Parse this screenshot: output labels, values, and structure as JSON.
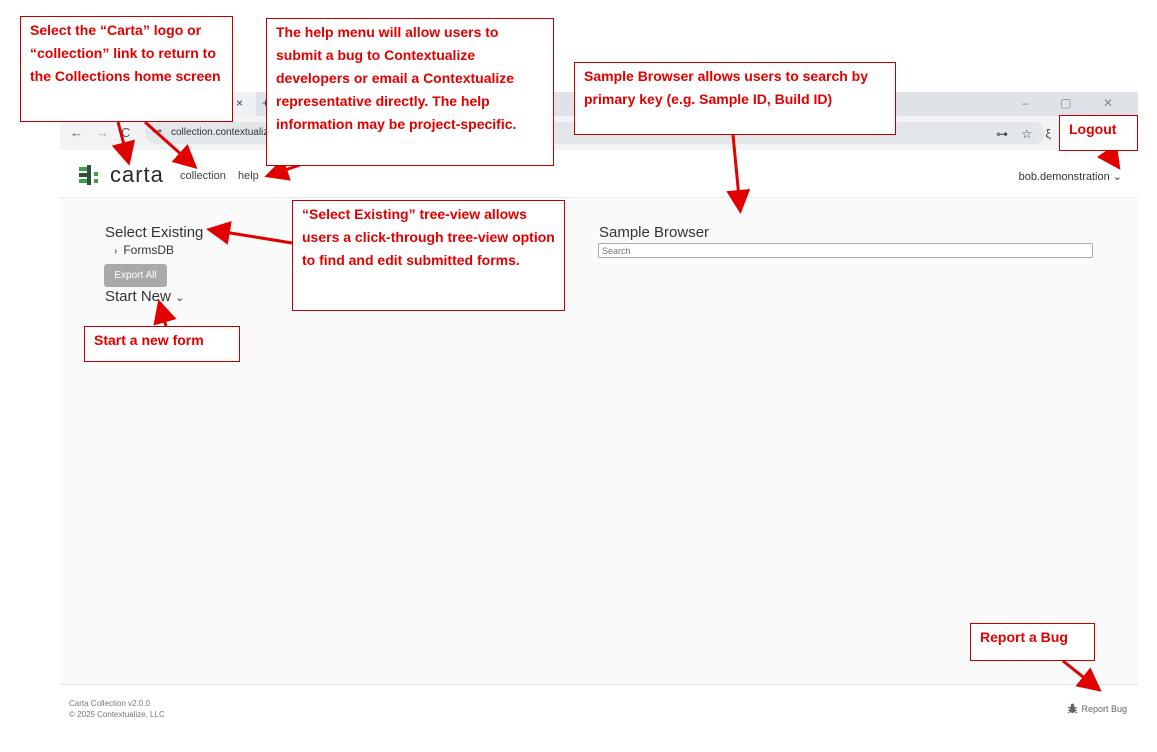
{
  "browser": {
    "tab_close": "×",
    "tab_new": "+",
    "window_controls": "–  ▢  ✕",
    "back": "←",
    "forward": "→",
    "reload": "C",
    "site_info": "⊶",
    "url": "collection.contextualiz",
    "key_icon": "⊶",
    "star_icon": "☆",
    "ext_icon": "ξ"
  },
  "header": {
    "logo_text": "carta",
    "nav": [
      "collection",
      "help"
    ],
    "user": "bob.demonstration",
    "user_caret": "⌄"
  },
  "main": {
    "select_existing_title": "Select Existing",
    "tree": [
      {
        "caret": "›",
        "label": "FormsDB"
      }
    ],
    "export_label": "Export All",
    "start_new_label": "Start New",
    "start_new_caret": "⌄",
    "sample_browser_title": "Sample Browser",
    "search_placeholder": "Search"
  },
  "footer": {
    "version": "Carta Collection v2.0.0",
    "copyright": "© 2025 Contextualize, LLC",
    "report_bug": "Report Bug"
  },
  "annotations": {
    "logo_note": "Select the “Carta” logo or “collection” link to return to the Collections home screen",
    "help_note": "The help menu will allow users to submit a bug to Contextualize developers or email a Contextualize representative directly. The help information may be project-specific.",
    "sample_note": "Sample Browser allows users to search by primary key (e.g. Sample ID, Build ID)",
    "logout_note": "Logout",
    "select_note": "“Select Existing” tree-view allows users a click-through tree-view option to find and edit submitted forms.",
    "start_note": "Start a new form",
    "bug_note": "Report a Bug"
  },
  "colors": {
    "annotation_red": "#e00000",
    "logo_green": "#3aa049",
    "logo_dark": "#2f4f3a",
    "export_button": "#a9a9a9"
  }
}
